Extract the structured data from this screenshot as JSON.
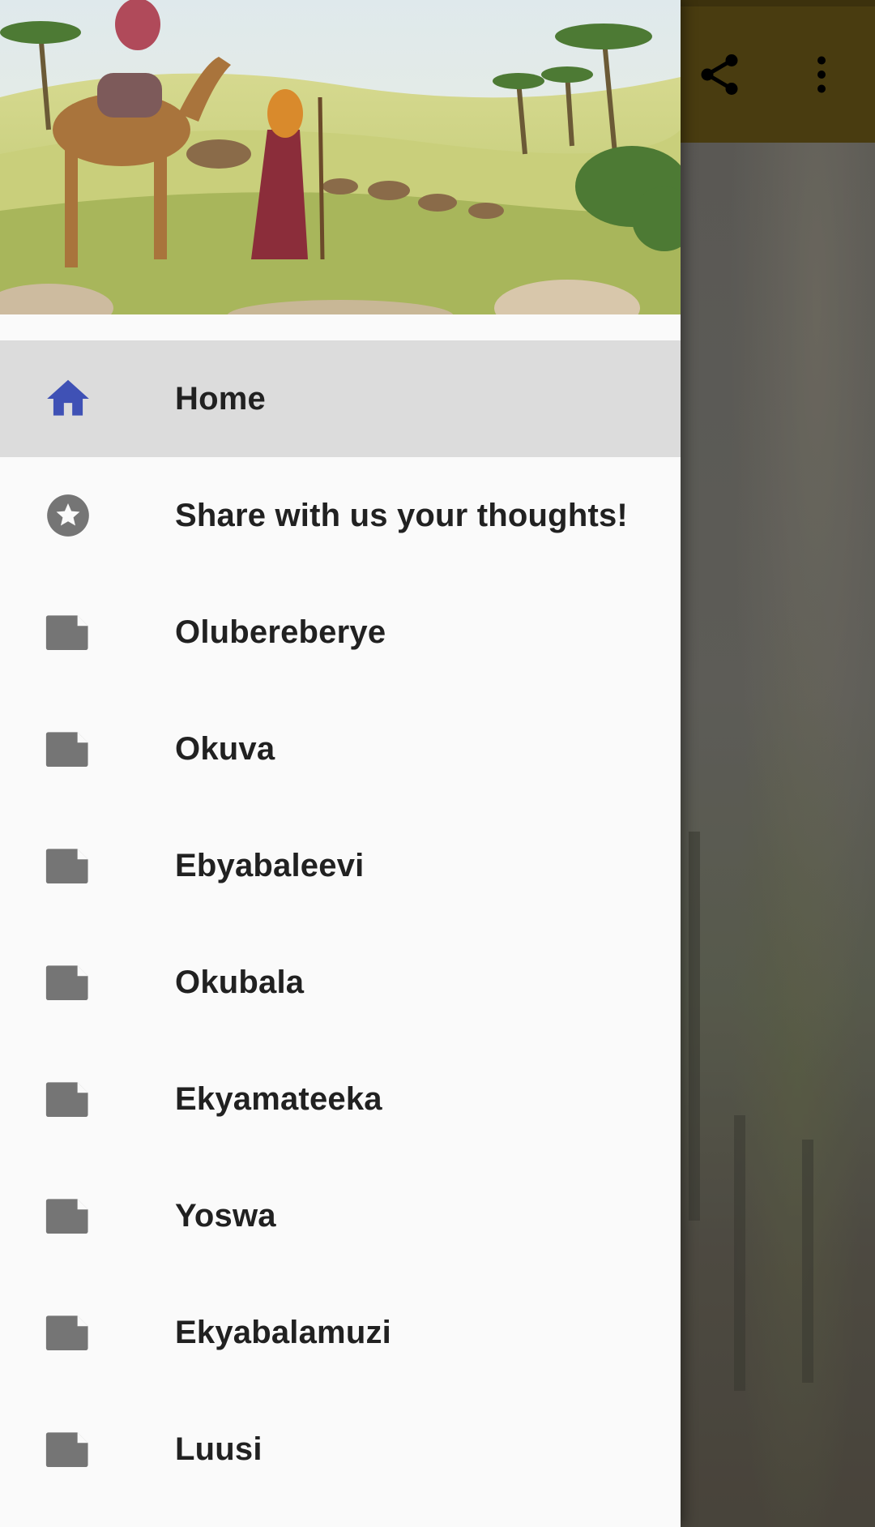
{
  "toolbar": {
    "share_icon": "share-icon",
    "overflow_icon": "more-vert-icon",
    "color": "#5a4a14"
  },
  "drawer": {
    "header_image": "caravan-illustration",
    "accent_color": "#3f51b5",
    "items": [
      {
        "label": "Home",
        "icon": "home-icon",
        "active": true
      },
      {
        "label": "Share with us your thoughts!",
        "icon": "star-circle-icon",
        "active": false
      },
      {
        "label": "Olubereberye",
        "icon": "document-icon",
        "active": false
      },
      {
        "label": "Okuva",
        "icon": "document-icon",
        "active": false
      },
      {
        "label": "Ebyabaleevi",
        "icon": "document-icon",
        "active": false
      },
      {
        "label": "Okubala",
        "icon": "document-icon",
        "active": false
      },
      {
        "label": "Ekyamateeka",
        "icon": "document-icon",
        "active": false
      },
      {
        "label": "Yoswa",
        "icon": "document-icon",
        "active": false
      },
      {
        "label": "Ekyabalamuzi",
        "icon": "document-icon",
        "active": false
      },
      {
        "label": "Luusi",
        "icon": "document-icon",
        "active": false
      }
    ]
  }
}
